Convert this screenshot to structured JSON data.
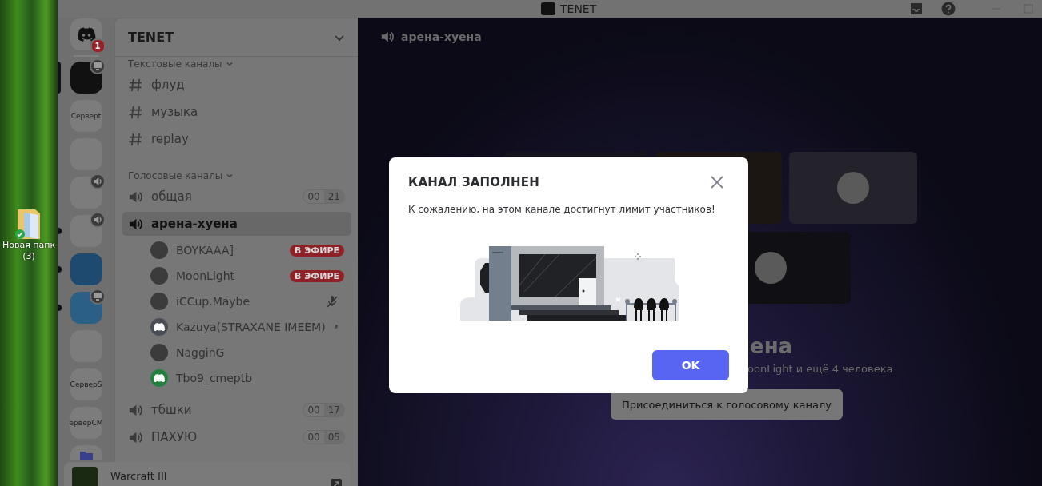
{
  "desktop": {
    "icon_label": [
      "Новая папк",
      "(3)"
    ]
  },
  "window": {
    "title": "TENET"
  },
  "servers": [
    {
      "kind": "home",
      "selected": false,
      "unread": false,
      "badge": "1",
      "screen_share": false,
      "in_voice": false
    },
    {
      "kind": "image",
      "selected": true,
      "unread": false,
      "screen_share": true,
      "in_voice": false,
      "color": "#111111"
    },
    {
      "kind": "text",
      "label": "Сервept",
      "selected": false,
      "unread": false,
      "screen_share": false,
      "in_voice": false
    },
    {
      "kind": "blank",
      "selected": false,
      "unread": false,
      "screen_share": false,
      "in_voice": false
    },
    {
      "kind": "blank",
      "selected": false,
      "unread": false,
      "screen_share": false,
      "in_voice": true
    },
    {
      "kind": "blank",
      "selected": false,
      "unread": true,
      "screen_share": false,
      "in_voice": true
    },
    {
      "kind": "image",
      "selected": false,
      "unread": true,
      "screen_share": false,
      "in_voice": false,
      "color": "#1d4a6e"
    },
    {
      "kind": "image",
      "selected": false,
      "unread": true,
      "screen_share": true,
      "in_voice": false,
      "color": "#2b5f86"
    },
    {
      "kind": "blank",
      "selected": false,
      "unread": false,
      "screen_share": false,
      "in_voice": false
    },
    {
      "kind": "text",
      "label": "СерверS",
      "selected": false,
      "unread": false,
      "screen_share": false,
      "in_voice": false
    },
    {
      "kind": "text",
      "label": "ерверСМ",
      "selected": false,
      "unread": false,
      "screen_share": false,
      "in_voice": false
    },
    {
      "kind": "folder",
      "selected": false,
      "unread": false,
      "screen_share": false,
      "in_voice": false
    }
  ],
  "server_header": {
    "name": "TENET"
  },
  "categories": [
    {
      "name": "Текстовые каналы",
      "expanded": true,
      "channels": [
        {
          "kind": "text",
          "name": "флуд",
          "selected": false
        },
        {
          "kind": "text",
          "name": "музыка",
          "selected": false
        },
        {
          "kind": "text",
          "name": "replay",
          "selected": false
        }
      ]
    },
    {
      "name": "Голосовые каналы",
      "expanded": true,
      "channels": [
        {
          "kind": "voice",
          "name": "общая",
          "selected": false,
          "user_count": "00",
          "user_limit": "21"
        },
        {
          "kind": "voice",
          "name": "арена-хуена",
          "selected": true,
          "members": [
            {
              "name": "BOYKAAA]",
              "kind": "photo",
              "badge": "В ЭФИРЕ",
              "muted": false
            },
            {
              "name": "MoonLight",
              "kind": "photo",
              "badge": "В ЭФИРЕ",
              "muted": false
            },
            {
              "name": "iCCup.Maybe",
              "kind": "photo",
              "muted": true
            },
            {
              "name": "Kazuya(STRAXANE IMEEM)",
              "kind": "default",
              "color": "#4a4d55",
              "muted": true
            },
            {
              "name": "NagginG",
              "kind": "photo",
              "muted": false
            },
            {
              "name": "Tbo9_cmeptb",
              "kind": "default",
              "color": "#24803f",
              "muted": false
            }
          ]
        },
        {
          "kind": "voice",
          "name": "тбшки",
          "selected": false,
          "user_count": "00",
          "user_limit": "17"
        },
        {
          "kind": "voice",
          "name": "ПАХУЮ",
          "selected": false,
          "user_count": "00",
          "user_limit": "05"
        }
      ]
    }
  ],
  "user_panel": {
    "activity": "Warcraft III"
  },
  "channel_header": {
    "name": "арена-хуена"
  },
  "tiles": [
    {
      "kind": "empty"
    },
    {
      "kind": "empty"
    },
    {
      "kind": "avatar"
    },
    {
      "kind": "avatar"
    }
  ],
  "stage": {
    "heading": "ена",
    "subtitle": "oonLight и ещё 4 человека",
    "join_button": "Присоединиться к голосовому каналу"
  },
  "modal": {
    "title": "КАНАЛ ЗАПОЛНЕН",
    "message": "К сожалению, на этом канале достигнут лимит участников!",
    "button": "OK"
  }
}
